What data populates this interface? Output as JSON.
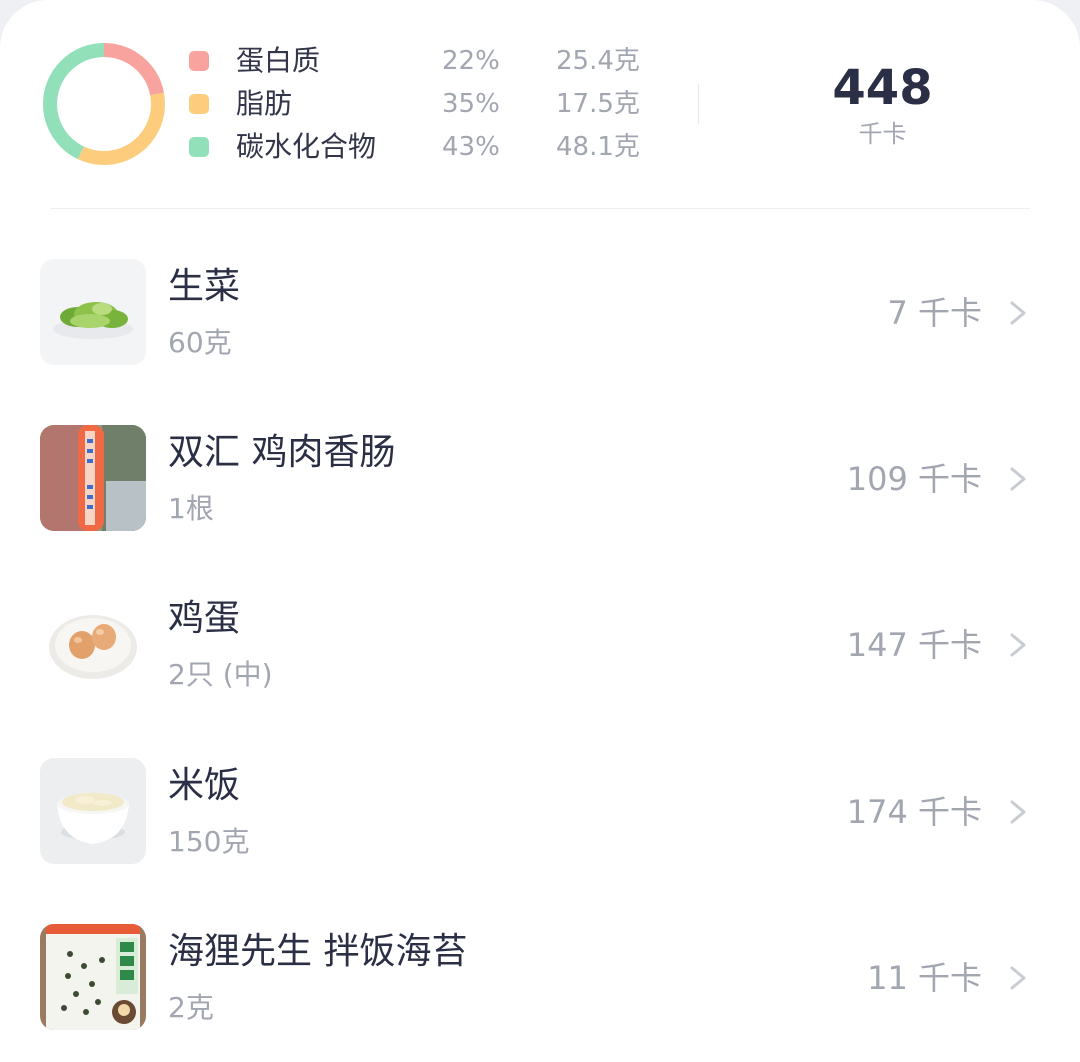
{
  "summary": {
    "macros": [
      {
        "name": "蛋白质",
        "percent": "22%",
        "amount": "25.4克",
        "color": "#f8a39e",
        "share": 0.22
      },
      {
        "name": "脂肪",
        "percent": "35%",
        "amount": "17.5克",
        "color": "#fdcd7d",
        "share": 0.35
      },
      {
        "name": "碳水化合物",
        "percent": "43%",
        "amount": "48.1克",
        "color": "#92e0b9",
        "share": 0.43
      }
    ],
    "total_value": "448",
    "total_unit": "千卡"
  },
  "foods": [
    {
      "name": "生菜",
      "amount": "60克",
      "kcal": "7 千卡",
      "icon": "lettuce-thumbnail"
    },
    {
      "name": "双汇 鸡肉香肠",
      "amount": "1根",
      "kcal": "109 千卡",
      "icon": "sausage-thumbnail"
    },
    {
      "name": "鸡蛋",
      "amount": "2只 (中)",
      "kcal": "147 千卡",
      "icon": "eggs-thumbnail"
    },
    {
      "name": "米饭",
      "amount": "150克",
      "kcal": "174 千卡",
      "icon": "rice-thumbnail"
    },
    {
      "name": "海狸先生 拌饭海苔",
      "amount": "2克",
      "kcal": "11 千卡",
      "icon": "seaweed-thumbnail"
    }
  ]
}
